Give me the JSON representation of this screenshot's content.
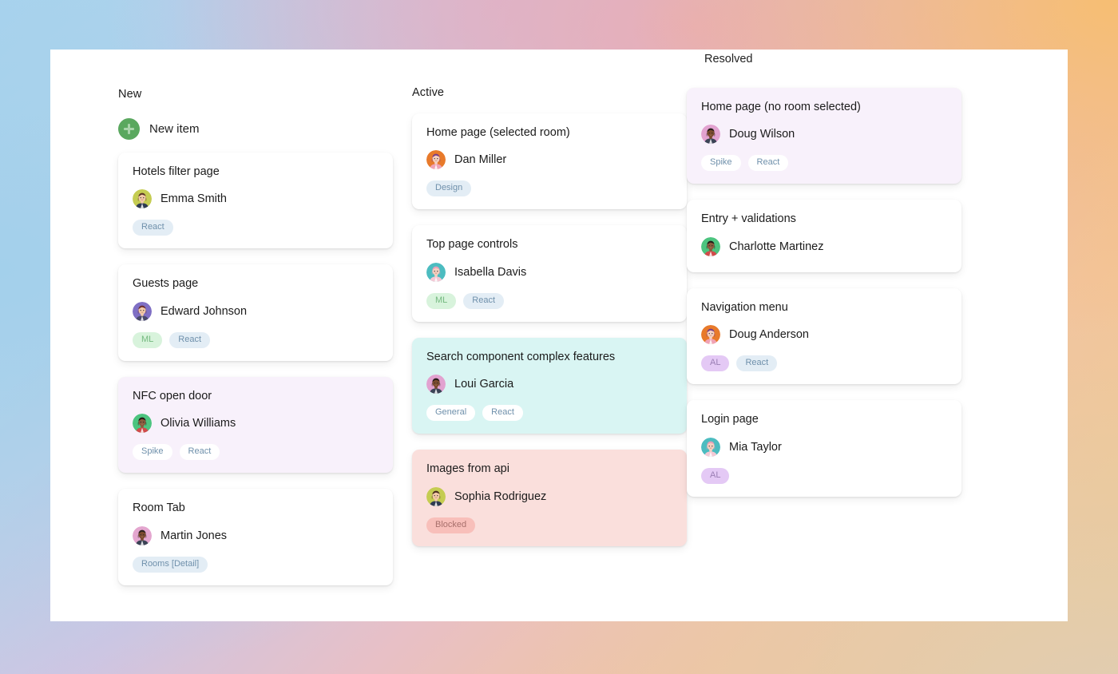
{
  "board": {
    "new_item_label": "New item",
    "plus_icon": "plus-icon"
  },
  "columns": [
    {
      "id": "new",
      "title": "New",
      "has_new_item": true,
      "cards": [
        {
          "title": "Hotels filter page",
          "assignee": "Emma Smith",
          "avatar": "avatar-emma-smith",
          "tint": "white",
          "tags": [
            {
              "label": "React",
              "style": "react"
            }
          ]
        },
        {
          "title": "Guests page",
          "assignee": "Edward Johnson",
          "avatar": "avatar-edward-johnson",
          "tint": "white",
          "tags": [
            {
              "label": "ML",
              "style": "ml"
            },
            {
              "label": "React",
              "style": "react"
            }
          ]
        },
        {
          "title": "NFC open door",
          "assignee": "Olivia Williams",
          "avatar": "avatar-olivia-williams",
          "tint": "purple",
          "tags": [
            {
              "label": "Spike",
              "style": "spike"
            },
            {
              "label": "React",
              "style": "react"
            }
          ]
        },
        {
          "title": "Room Tab",
          "assignee": "Martin Jones",
          "avatar": "avatar-martin-jones",
          "tint": "white",
          "tags": [
            {
              "label": "Rooms [Detail]",
              "style": "rooms"
            }
          ]
        }
      ]
    },
    {
      "id": "active",
      "title": "Active",
      "has_new_item": false,
      "cards": [
        {
          "title": "Home page (selected room)",
          "assignee": "Dan Miller",
          "avatar": "avatar-dan-miller",
          "tint": "white",
          "tags": [
            {
              "label": "Design",
              "style": "design"
            }
          ]
        },
        {
          "title": "Top page controls",
          "assignee": "Isabella Davis",
          "avatar": "avatar-isabella-davis",
          "tint": "white",
          "tags": [
            {
              "label": "ML",
              "style": "ml"
            },
            {
              "label": "React",
              "style": "react"
            }
          ]
        },
        {
          "title": "Search component complex features",
          "assignee": "Loui Garcia",
          "avatar": "avatar-loui-garcia",
          "tint": "cyan",
          "tags": [
            {
              "label": "General",
              "style": "general"
            },
            {
              "label": "React",
              "style": "react"
            }
          ]
        },
        {
          "title": "Images from api",
          "assignee": "Sophia Rodriguez",
          "avatar": "avatar-sophia-rodriguez",
          "tint": "pink",
          "tags": [
            {
              "label": "Blocked",
              "style": "blocked"
            }
          ]
        }
      ]
    },
    {
      "id": "resolved",
      "title": "Resolved",
      "has_new_item": false,
      "cards": [
        {
          "title": "Home page (no room selected)",
          "assignee": "Doug Wilson",
          "avatar": "avatar-doug-wilson",
          "tint": "purple",
          "tags": [
            {
              "label": "Spike",
              "style": "spike"
            },
            {
              "label": "React",
              "style": "react"
            }
          ]
        },
        {
          "title": "Entry + validations",
          "assignee": "Charlotte Martinez",
          "avatar": "avatar-charlotte-martinez",
          "tint": "white",
          "tags": []
        },
        {
          "title": "Navigation menu",
          "assignee": "Doug Anderson",
          "avatar": "avatar-doug-anderson",
          "tint": "white",
          "tags": [
            {
              "label": "AL",
              "style": "al"
            },
            {
              "label": "React",
              "style": "react"
            }
          ]
        },
        {
          "title": "Login page",
          "assignee": "Mia Taylor",
          "avatar": "avatar-mia-taylor",
          "tint": "white",
          "tags": [
            {
              "label": "AL",
              "style": "al"
            }
          ]
        }
      ]
    }
  ],
  "colors": {
    "accent_green": "#5aa85f",
    "tag_react_bg": "#e3edf5",
    "tag_ml_bg": "#d8f3dc",
    "tag_al_bg": "#e4c9f5",
    "tag_blocked_bg": "#f8bfba",
    "card_tint_purple": "#f8f1fb",
    "card_tint_cyan": "#d9f5f3",
    "card_tint_pink": "#fadfdc",
    "panel_bg": "#ffffff"
  },
  "avatar_palettes": {
    "avatar-emma-smith": {
      "bg": "#c5cc52",
      "skin": "#f2c9a8",
      "hair": "#5c3526",
      "shirt": "#2f3b52"
    },
    "avatar-edward-johnson": {
      "bg": "#7f6fc4",
      "skin": "#f2c9a8",
      "hair": "#6b2f2f",
      "shirt": "#4a4a6a"
    },
    "avatar-olivia-williams": {
      "bg": "#4cc47f",
      "skin": "#8a5a3c",
      "hair": "#211a16",
      "shirt": "#d24b4b"
    },
    "avatar-martin-jones": {
      "bg": "#e4a6cf",
      "skin": "#7a4a2e",
      "hair": "#2b211c",
      "shirt": "#3b4456"
    },
    "avatar-dan-miller": {
      "bg": "#e87a2b",
      "skin": "#f5cfc0",
      "hair": "#7a3f86",
      "shirt": "#f0a3b5"
    },
    "avatar-isabella-davis": {
      "bg": "#4cbcc0",
      "skin": "#f5cfc0",
      "hair": "#e8a0b8",
      "shirt": "#f4c9d5"
    },
    "avatar-loui-garcia": {
      "bg": "#e2a2d0",
      "skin": "#7a4a2e",
      "hair": "#241c18",
      "shirt": "#3b4456"
    },
    "avatar-sophia-rodriguez": {
      "bg": "#c5cc52",
      "skin": "#f2c9a8",
      "hair": "#4a2c1e",
      "shirt": "#2f3b52"
    },
    "avatar-doug-wilson": {
      "bg": "#e2a2d0",
      "skin": "#7a4a2e",
      "hair": "#241c18",
      "shirt": "#3b4456"
    },
    "avatar-charlotte-martinez": {
      "bg": "#4cc47f",
      "skin": "#8a5a3c",
      "hair": "#211a16",
      "shirt": "#d24b4b"
    },
    "avatar-doug-anderson": {
      "bg": "#e87a2b",
      "skin": "#f5cfc0",
      "hair": "#7a3f86",
      "shirt": "#f0a3b5"
    },
    "avatar-mia-taylor": {
      "bg": "#4cbcc0",
      "skin": "#f5cfc0",
      "hair": "#e8a0b8",
      "shirt": "#f4c9d5"
    }
  }
}
